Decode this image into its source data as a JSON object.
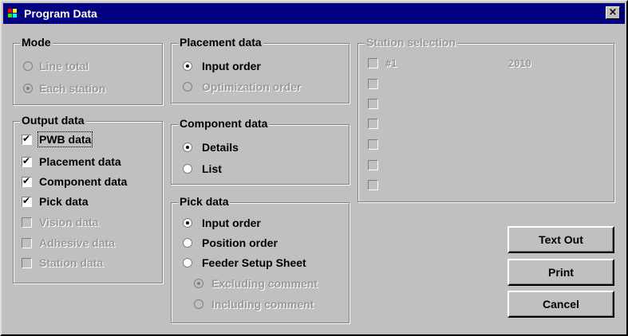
{
  "window": {
    "title": "Program Data",
    "close_label": "×"
  },
  "mode": {
    "title": "Mode",
    "options": [
      {
        "label": "Line total",
        "selected": false,
        "enabled": false
      },
      {
        "label": "Each station",
        "selected": true,
        "enabled": false
      }
    ]
  },
  "output_data": {
    "title": "Output data",
    "items": [
      {
        "label": "PWB data",
        "checked": true,
        "enabled": true
      },
      {
        "label": "Placement data",
        "checked": true,
        "enabled": true
      },
      {
        "label": "Component data",
        "checked": true,
        "enabled": true
      },
      {
        "label": "Pick data",
        "checked": true,
        "enabled": true
      },
      {
        "label": "Vision data",
        "checked": false,
        "enabled": false
      },
      {
        "label": "Adhesive data",
        "checked": false,
        "enabled": false
      },
      {
        "label": "Station data",
        "checked": false,
        "enabled": false
      }
    ]
  },
  "placement_data": {
    "title": "Placement data",
    "options": [
      {
        "label": "Input order",
        "selected": true,
        "enabled": true
      },
      {
        "label": "Optimization order",
        "selected": false,
        "enabled": false
      }
    ]
  },
  "component_data": {
    "title": "Component data",
    "options": [
      {
        "label": "Details",
        "selected": true,
        "enabled": true
      },
      {
        "label": "List",
        "selected": false,
        "enabled": true
      }
    ]
  },
  "pick_data": {
    "title": "Pick data",
    "options": [
      {
        "label": "Input order",
        "selected": true,
        "enabled": true
      },
      {
        "label": "Position order",
        "selected": false,
        "enabled": true
      },
      {
        "label": "Feeder Setup Sheet",
        "selected": false,
        "enabled": true
      }
    ],
    "sub_options": [
      {
        "label": "Excluding comment",
        "selected": true,
        "enabled": false
      },
      {
        "label": "Including comment",
        "selected": false,
        "enabled": false
      }
    ]
  },
  "station_selection": {
    "title": "Station selection",
    "rows": [
      {
        "number": "#1",
        "value": "2010"
      },
      {
        "number": "",
        "value": ""
      },
      {
        "number": "",
        "value": ""
      },
      {
        "number": "",
        "value": ""
      },
      {
        "number": "",
        "value": ""
      },
      {
        "number": "",
        "value": ""
      },
      {
        "number": "",
        "value": ""
      }
    ]
  },
  "buttons": {
    "text_out": "Text Out",
    "print": "Print",
    "cancel": "Cancel"
  },
  "colors": {
    "face": "#c0c0c0",
    "titlebar": "#000080",
    "disabled_text": "#9a9a9a"
  },
  "icons": {
    "title_icon": "program-data-icon",
    "close": "close-icon"
  }
}
